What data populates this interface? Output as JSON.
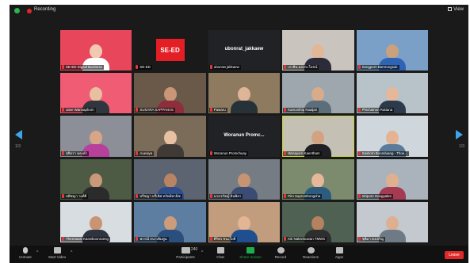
{
  "topbar": {
    "recording_label": "Recording",
    "view_label": "View"
  },
  "pagination": {
    "left": "1/3",
    "right": "1/3"
  },
  "tiles": [
    {
      "name": "SE-ED Digital Business",
      "kind": "photo",
      "bg": "#e8465a",
      "skin": "#f1c8b0",
      "shirt": "#ffffff"
    },
    {
      "name": "SE-ED",
      "kind": "logo",
      "logo": "SE-ED"
    },
    {
      "name": "ubonrat jakkaew",
      "kind": "text",
      "text": "ubonrat_jakkaew"
    },
    {
      "name": "เกวลิน ผลประโยชน์",
      "kind": "photo",
      "bg": "#c9c4bd",
      "skin": "#e2b797",
      "shirt": "#2b2b3a"
    },
    {
      "name": "Songporn Bamrungsuk",
      "kind": "photo",
      "bg": "#7aa0c8",
      "skin": "#caa07d",
      "shirt": "#2f63b3"
    },
    {
      "name": "Jane Wannaphorn",
      "kind": "photo",
      "bg": "#f05c73",
      "skin": "#e8bfa0",
      "shirt": "#30363d"
    },
    {
      "name": "SUSARA SAPPANAS",
      "kind": "photo",
      "bg": "#6a5849",
      "skin": "#c99778",
      "shirt": "#8e2d3b"
    },
    {
      "name": "Pawaru",
      "kind": "photo",
      "bg": "#8d7a5f",
      "skin": "#e0b497",
      "shirt": "#273238"
    },
    {
      "name": "Kamonthip Nualjan",
      "kind": "photo",
      "bg": "#9ea7ae",
      "skin": "#d8ab8a",
      "shirt": "#5c6e7a"
    },
    {
      "name": "Phichamon Rattana",
      "kind": "photo",
      "bg": "#b7c3c8",
      "skin": "#e5b89a",
      "shirt": "#2c3a4b"
    },
    {
      "name": "สุจิตรา ทองคำ",
      "kind": "photo",
      "bg": "#8c8f97",
      "skin": "#d7a688",
      "shirt": "#b6409a"
    },
    {
      "name": "Aueaiya",
      "kind": "photo",
      "bg": "#7b6c5a",
      "skin": "#e8c0a2",
      "shirt": "#3f3a36"
    },
    {
      "name": "Woranun Promchuay",
      "kind": "text",
      "text": "Woranun  Promc..."
    },
    {
      "name": "Waraporn Kaentham",
      "kind": "photo",
      "bg": "#c5c0b4",
      "skin": "#d2a283",
      "shirt": "#1f1f24",
      "active": true
    },
    {
      "name": "Sasitorn Boonduang - Thoe...",
      "kind": "photo",
      "bg": "#cfd6dc",
      "skin": "#e3b393",
      "shirt": "#5b7b98"
    },
    {
      "name": "ปพิชญา วงศ์ดี",
      "kind": "photo",
      "bg": "#4d5a44",
      "skin": "#c9997a",
      "shirt": "#2b2b2b"
    },
    {
      "name": "ปรีชญา ทวีเลิศ ทรัพย์พานิช",
      "kind": "photo",
      "bg": "#5b6470",
      "skin": "#b98463",
      "shirt": "#2d4e8a"
    },
    {
      "name": "นายวรัชญ์ อินพิลา",
      "kind": "photo",
      "bg": "#767c84",
      "skin": "#c69473",
      "shirt": "#3a4c74"
    },
    {
      "name": "Pim Supronthongcha",
      "kind": "photo",
      "bg": "#7c8a6d",
      "skin": "#e6b899",
      "shirt": "#2c5c7e"
    },
    {
      "name": "Siriporn Hongyalee",
      "kind": "photo",
      "bg": "#aab3bb",
      "skin": "#deb090",
      "shirt": "#a53a53"
    },
    {
      "name": "Theerawat Kaewboonrueng",
      "kind": "photo",
      "bg": "#d8dde1",
      "skin": "#c99473",
      "shirt": "#2e3440"
    },
    {
      "name": "พรรณี ธนาเพิ่มพูน",
      "kind": "photo",
      "bg": "#5e7ea1",
      "skin": "#cc9c7b",
      "shirt": "#2b4f7d"
    },
    {
      "name": "ศิริพร ชนะโยธี",
      "kind": "photo",
      "bg": "#c19d7e",
      "skin": "#e3b595",
      "shirt": "#1f4f8f"
    },
    {
      "name": "Kiti Naksrisuwan TMWS",
      "kind": "photo",
      "bg": "#4e6152",
      "skin": "#b5825f",
      "shirt": "#2e2e2e"
    },
    {
      "name": "ชุติมา คงเจริญ",
      "kind": "photo",
      "bg": "#c3c9ce",
      "skin": "#deb092",
      "shirt": "#6e7b86"
    }
  ],
  "toolbar": {
    "unmute": "Unmute",
    "start_video": "Start Video",
    "participants": "Participants",
    "participants_count": "240",
    "chat": "Chat",
    "share_screen": "Share Screen",
    "record": "Record",
    "reactions": "Reactions",
    "apps": "Apps",
    "leave": "Leave"
  },
  "colors": {
    "accent": "#3ea5e8",
    "share": "#1fae4b",
    "leave": "#e02828",
    "active_border": "#c8d632"
  }
}
